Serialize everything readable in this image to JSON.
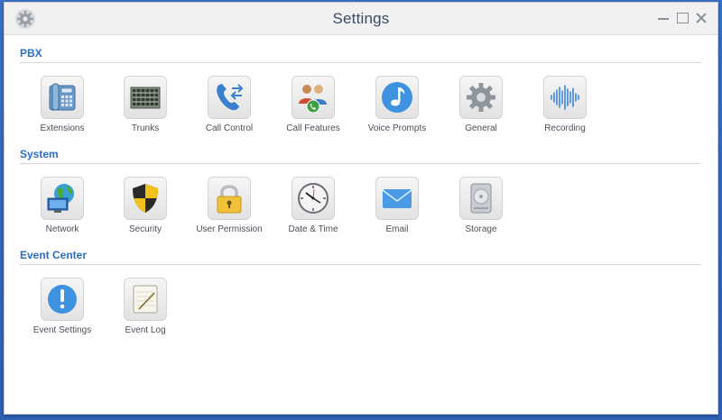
{
  "window": {
    "title": "Settings"
  },
  "sections": [
    {
      "title": "PBX",
      "items": [
        {
          "label": "Extensions",
          "icon": "phone-icon"
        },
        {
          "label": "Trunks",
          "icon": "trunk-icon"
        },
        {
          "label": "Call Control",
          "icon": "call-control-icon"
        },
        {
          "label": "Call Features",
          "icon": "call-features-icon"
        },
        {
          "label": "Voice Prompts",
          "icon": "music-note-icon"
        },
        {
          "label": "General",
          "icon": "gear-icon"
        },
        {
          "label": "Recording",
          "icon": "waveform-icon"
        }
      ]
    },
    {
      "title": "System",
      "items": [
        {
          "label": "Network",
          "icon": "network-globe-icon"
        },
        {
          "label": "Security",
          "icon": "shield-icon"
        },
        {
          "label": "User Permission",
          "icon": "padlock-icon"
        },
        {
          "label": "Date & Time",
          "icon": "clock-icon"
        },
        {
          "label": "Email",
          "icon": "envelope-icon"
        },
        {
          "label": "Storage",
          "icon": "hard-drive-icon"
        }
      ]
    },
    {
      "title": "Event Center",
      "items": [
        {
          "label": "Event Settings",
          "icon": "exclamation-icon"
        },
        {
          "label": "Event Log",
          "icon": "notepad-icon"
        }
      ]
    }
  ],
  "colors": {
    "accent": "#2d6ec7",
    "desktop": "#3b6fc4"
  }
}
